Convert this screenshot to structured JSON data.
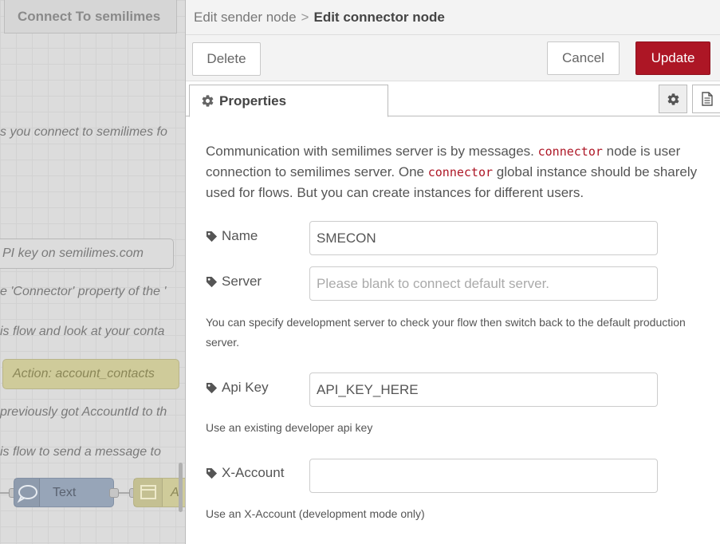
{
  "canvas": {
    "tab_title": "Connect To semilimes",
    "comment_1": "s you connect to semilimes fo",
    "apikey_box": "PI key on semilimes.com",
    "comment_2": "e 'Connector' property of the '",
    "comment_3": "is flow and look at your conta",
    "action_node": "Action: account_contacts",
    "comment_4": "previously got AccountId to th",
    "comment_5": "is flow to send a message to",
    "text_node": "Text",
    "a_node": "A"
  },
  "header": {
    "crumb": "Edit sender node",
    "separator": ">",
    "current": "Edit connector node"
  },
  "toolbar": {
    "delete_label": "Delete",
    "cancel_label": "Cancel",
    "update_label": "Update",
    "update_color": "#ad1625"
  },
  "tabs": {
    "properties_label": "Properties",
    "settings_icon": "gear-icon",
    "description_icon": "file-text-icon"
  },
  "form": {
    "intro_part1": "Communication with semilimes server is by messages. ",
    "intro_code1": "connector",
    "intro_part2": " node is user connection to semilimes server. One ",
    "intro_code2": "connector",
    "intro_part3": " global instance should be sharely used for flows. But you can create instances for different users.",
    "name_label": "Name",
    "name_value": "SMECON",
    "server_label": "Server",
    "server_placeholder": "Please blank to connect default server.",
    "server_help": "You can specify development server to check your flow then switch back to the default production server.",
    "apikey_label": "Api Key",
    "apikey_value": "API_KEY_HERE",
    "apikey_help": "Use an existing developer api key",
    "xaccount_label": "X-Account",
    "xaccount_value": "",
    "xaccount_help": "Use an X-Account (development mode only)"
  }
}
